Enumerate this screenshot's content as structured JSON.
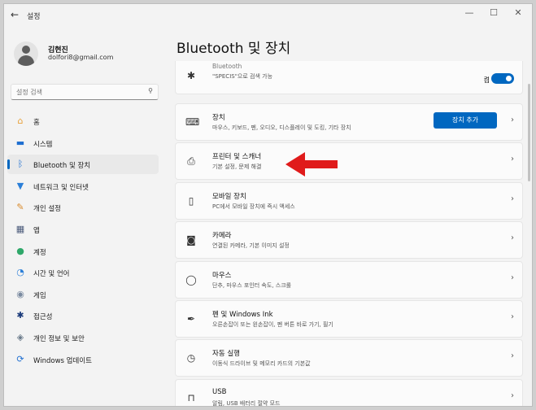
{
  "window": {
    "back_glyph": "←",
    "title": "설정",
    "controls": {
      "minimize": "—",
      "maximize": "☐",
      "close": "✕"
    }
  },
  "profile": {
    "name": "김현진",
    "email": "dolfori8@gmail.com"
  },
  "search": {
    "placeholder": "설정 검색"
  },
  "nav": [
    {
      "label": "홈",
      "icon": "home-icon",
      "glyph": "⌂",
      "color": "#e8a13a",
      "active": false
    },
    {
      "label": "시스템",
      "icon": "monitor-icon",
      "glyph": "▬",
      "color": "#1f6fd1",
      "active": false
    },
    {
      "label": "Bluetooth 및 장치",
      "icon": "bluetooth-icon",
      "glyph": "ᛒ",
      "color": "#1f6fd1",
      "active": true
    },
    {
      "label": "네트워크 및 인터넷",
      "icon": "wifi-icon",
      "glyph": "▼",
      "color": "#2b7fd8",
      "active": false
    },
    {
      "label": "개인 설정",
      "icon": "brush-icon",
      "glyph": "✎",
      "color": "#d98a2b",
      "active": false
    },
    {
      "label": "앱",
      "icon": "apps-icon",
      "glyph": "▦",
      "color": "#4a5a7a",
      "active": false
    },
    {
      "label": "계정",
      "icon": "account-icon",
      "glyph": "●",
      "color": "#2fa86a",
      "active": false
    },
    {
      "label": "시간 및 언어",
      "icon": "globe-clock-icon",
      "glyph": "◔",
      "color": "#2b7fd8",
      "active": false
    },
    {
      "label": "게임",
      "icon": "gamepad-icon",
      "glyph": "◉",
      "color": "#7a8aa0",
      "active": false
    },
    {
      "label": "접근성",
      "icon": "accessibility-icon",
      "glyph": "✱",
      "color": "#1a3a7a",
      "active": false
    },
    {
      "label": "개인 정보 및 보안",
      "icon": "shield-icon",
      "glyph": "◈",
      "color": "#6a7a8a",
      "active": false
    },
    {
      "label": "Windows 업데이트",
      "icon": "update-icon",
      "glyph": "⟳",
      "color": "#1f6fd1",
      "active": false
    }
  ],
  "main": {
    "title": "Bluetooth 및 장치",
    "bluetooth_card": {
      "title": "Bluetooth",
      "subtitle": "\"SPECIS\"으로 검색 가능",
      "state": "켬",
      "icon": "bluetooth-icon",
      "glyph": "✱"
    },
    "cards": [
      {
        "title": "장치",
        "subtitle": "마우스, 키보드, 펜, 오디오, 디스플레이 및 도킹, 기타 장치",
        "icon": "keyboard-icon",
        "glyph": "⌨",
        "button": "장치 추가"
      },
      {
        "title": "프린터 및 스캐너",
        "subtitle": "기본 설정, 문제 해결",
        "icon": "printer-icon",
        "glyph": "⎙"
      },
      {
        "title": "모바일 장치",
        "subtitle": "PC에서 모바일 장치에 즉시 액세스",
        "icon": "phone-icon",
        "glyph": "▯"
      },
      {
        "title": "카메라",
        "subtitle": "연결된 카메라, 기본 이미지 설정",
        "icon": "camera-icon",
        "glyph": "◙"
      },
      {
        "title": "마우스",
        "subtitle": "단추, 마우스 포인터 속도, 스크롤",
        "icon": "mouse-icon",
        "glyph": "◯"
      },
      {
        "title": "펜 및 Windows Ink",
        "subtitle": "오른손잡이 또는 왼손잡이, 펜 버튼 바로 가기, 필기",
        "icon": "pen-icon",
        "glyph": "✒"
      },
      {
        "title": "자동 실행",
        "subtitle": "이동식 드라이브 및 메모리 카드의 기본값",
        "icon": "autoplay-icon",
        "glyph": "◷"
      },
      {
        "title": "USB",
        "subtitle": "알림, USB 배터리 절약 모드",
        "icon": "usb-icon",
        "glyph": "⊓"
      }
    ],
    "chevron": "›",
    "accent": "#0067c0",
    "arrow_color": "#e01b1b"
  }
}
